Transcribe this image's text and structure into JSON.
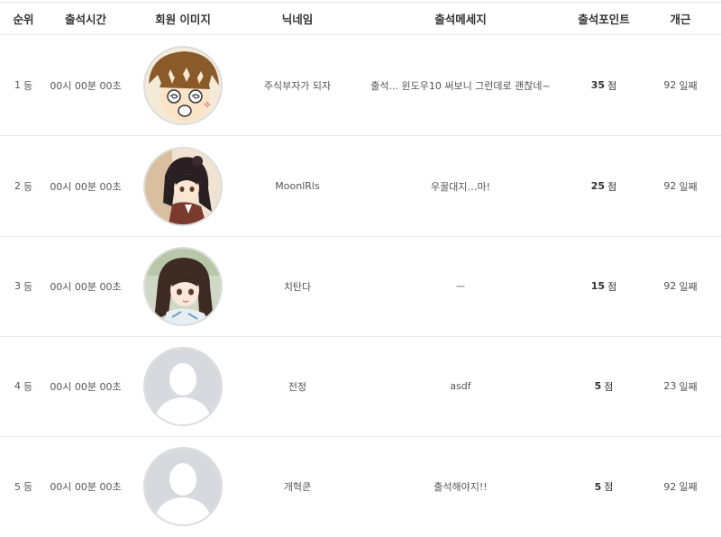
{
  "headers": {
    "rank": "순위",
    "time": "출석시간",
    "image": "회원 이미지",
    "nickname": "닉네임",
    "message": "출석메세지",
    "points": "출석포인트",
    "days": "개근"
  },
  "rows": [
    {
      "rank": "1",
      "rank_unit": "등",
      "time": "00시 00분 00초",
      "avatar": "anime-boy-avatar",
      "nickname": "주식부자가 되자",
      "message": "출석... 윈도우10 써보니 그런데로 괜찮네~",
      "points": "35",
      "points_unit": "점",
      "days": "92",
      "days_unit": "일째"
    },
    {
      "rank": "2",
      "rank_unit": "등",
      "time": "00시 00분 00초",
      "avatar": "anime-girl-dark-hair-avatar",
      "nickname": "MoonlRls",
      "message": "우꿀대지…마!",
      "points": "25",
      "points_unit": "점",
      "days": "92",
      "days_unit": "일째"
    },
    {
      "rank": "3",
      "rank_unit": "등",
      "time": "00시 00분 00초",
      "avatar": "anime-girl-brown-hair-avatar",
      "nickname": "치탄다",
      "message": "ㅡ",
      "points": "15",
      "points_unit": "점",
      "days": "92",
      "days_unit": "일째"
    },
    {
      "rank": "4",
      "rank_unit": "등",
      "time": "00시 00분 00초",
      "avatar": "default-user-avatar",
      "nickname": "전정",
      "message": "asdf",
      "points": "5",
      "points_unit": "점",
      "days": "23",
      "days_unit": "일째"
    },
    {
      "rank": "5",
      "rank_unit": "등",
      "time": "00시 00분 00초",
      "avatar": "default-user-avatar",
      "nickname": "개혁쿤",
      "message": "출석해야지!!",
      "points": "5",
      "points_unit": "점",
      "days": "92",
      "days_unit": "일째"
    }
  ]
}
